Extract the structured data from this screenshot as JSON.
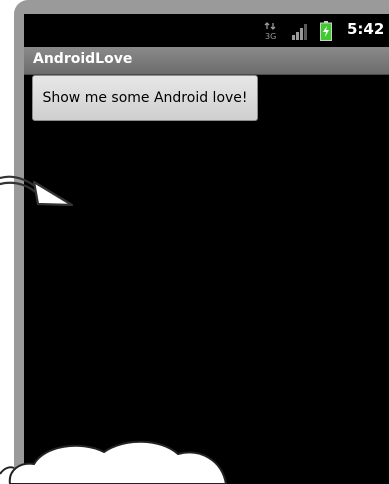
{
  "status_bar": {
    "time": "5:42",
    "icons": [
      "data-network-icon",
      "signal-strength-icon",
      "battery-charging-icon"
    ],
    "battery_color": "#3fcb2f"
  },
  "app": {
    "title": "AndroidLove"
  },
  "main": {
    "button_label": "Show me some Android love!"
  },
  "annotations": {
    "icons": [
      "hand-drawn-arrow-icon",
      "speech-cloud-icon"
    ]
  },
  "colors": {
    "screen_background": "#000000",
    "title_bar": "#7a7a7a",
    "device_frame": "#9a9a9a",
    "button_background": "#dcdcdc"
  }
}
